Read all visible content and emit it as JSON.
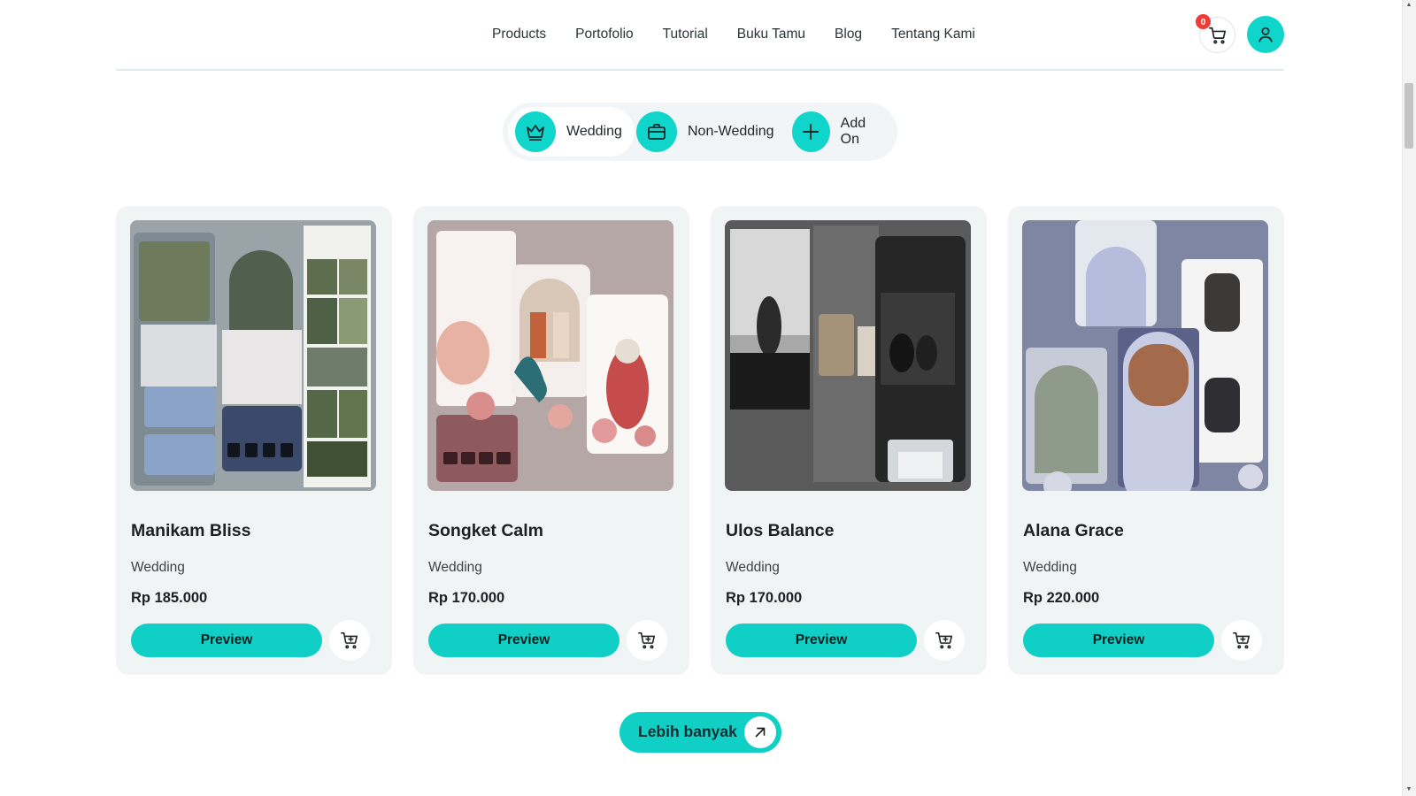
{
  "nav": {
    "items": [
      "Products",
      "Portofolio",
      "Tutorial",
      "Buku Tamu",
      "Blog",
      "Tentang Kami"
    ],
    "cart_count": "0",
    "cart_icon": "cart-icon",
    "user_icon": "user-icon"
  },
  "tabs": [
    {
      "label": "Wedding",
      "icon": "crown-icon",
      "active": true
    },
    {
      "label": "Non-Wedding",
      "icon": "briefcase-icon",
      "active": false
    },
    {
      "label": "Add On",
      "icon": "plus-icon",
      "active": false
    }
  ],
  "products": [
    {
      "name": "Manikam Bliss",
      "category": "Wedding",
      "price": "Rp 185.000",
      "preview_label": "Preview"
    },
    {
      "name": "Songket Calm",
      "category": "Wedding",
      "price": "Rp 170.000",
      "preview_label": "Preview"
    },
    {
      "name": "Ulos Balance",
      "category": "Wedding",
      "price": "Rp 170.000",
      "preview_label": "Preview"
    },
    {
      "name": "Alana Grace",
      "category": "Wedding",
      "price": "Rp 220.000",
      "preview_label": "Preview"
    }
  ],
  "more": {
    "label": "Lebih banyak",
    "icon": "arrow-up-right-icon"
  },
  "colors": {
    "accent": "#10d5cb",
    "card_bg": "#f0f4f5",
    "badge": "#ef3b36"
  }
}
